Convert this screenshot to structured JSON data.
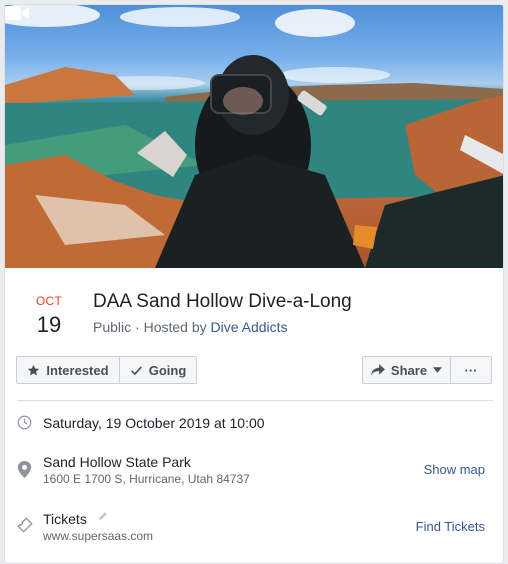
{
  "event": {
    "month": "OCT",
    "day": "19",
    "title": "DAA Sand Hollow Dive-a-Long",
    "visibility": "Public",
    "hosted_prefix": " · Hosted by ",
    "host": "Dive Addicts"
  },
  "actions": {
    "interested_label": "Interested",
    "going_label": "Going",
    "share_label": "Share",
    "more_label": "···"
  },
  "details": {
    "datetime": "Saturday, 19 October 2019 at 10:00",
    "location_name": "Sand Hollow State Park",
    "location_address": "1600 E 1700 S, Hurricane, Utah 84737",
    "show_map": "Show map",
    "tickets_label": "Tickets",
    "tickets_site": "www.supersaas.com",
    "find_tickets": "Find Tickets"
  },
  "icons": {
    "cover": "video-icon",
    "interested": "star-icon",
    "going": "checkmark-icon",
    "share": "share-arrow-icon",
    "time": "clock-icon",
    "location": "map-pin-icon",
    "tickets": "ticket-icon",
    "edit": "pencil-icon"
  },
  "colors": {
    "month": "#e0442c",
    "link": "#385898",
    "muted": "#606770"
  }
}
